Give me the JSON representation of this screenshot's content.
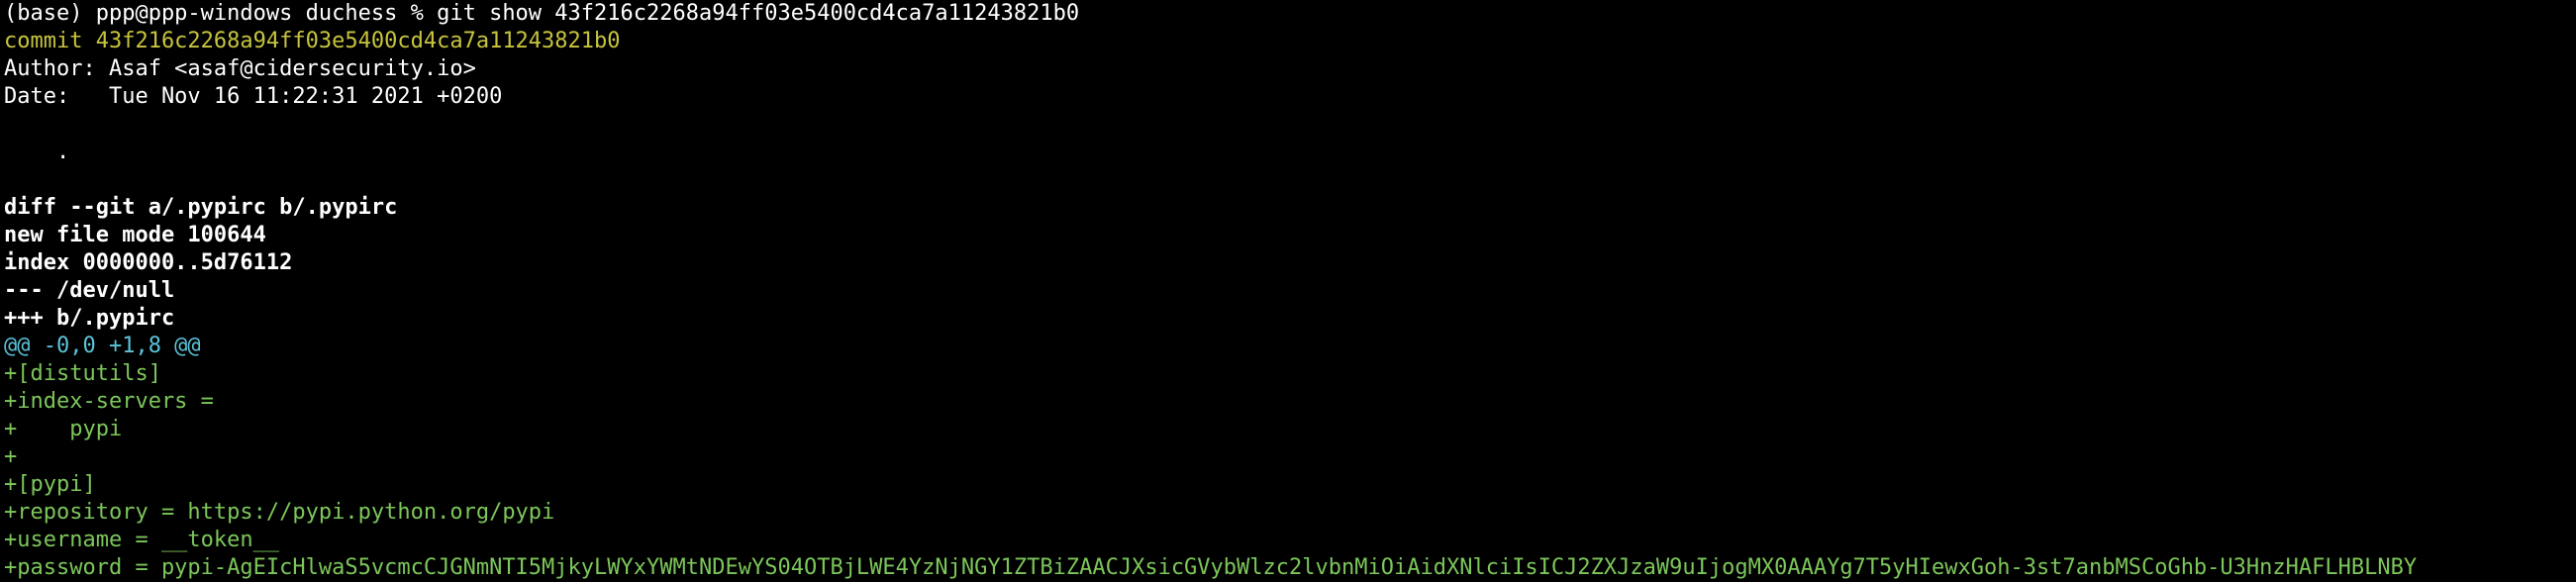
{
  "terminal": {
    "lines": [
      {
        "text": "(base) ppp@ppp-windows duchess % git show 43f216c2268a94ff03e5400cd4ca7a11243821b0",
        "kind": "prompt"
      },
      {
        "text": "commit 43f216c2268a94ff03e5400cd4ca7a11243821b0",
        "kind": "commit"
      },
      {
        "text": "Author: Asaf <asaf@cidersecurity.io>",
        "kind": "plain"
      },
      {
        "text": "Date:   Tue Nov 16 11:22:31 2021 +0200",
        "kind": "plain"
      },
      {
        "text": "",
        "kind": "plain"
      },
      {
        "text": "    .",
        "kind": "plain"
      },
      {
        "text": "",
        "kind": "plain"
      },
      {
        "text": "diff --git a/.pypirc b/.pypirc",
        "kind": "bold"
      },
      {
        "text": "new file mode 100644",
        "kind": "bold"
      },
      {
        "text": "index 0000000..5d76112",
        "kind": "bold"
      },
      {
        "text": "--- /dev/null",
        "kind": "bold"
      },
      {
        "text": "+++ b/.pypirc",
        "kind": "bold"
      },
      {
        "text": "@@ -0,0 +1,8 @@",
        "kind": "hunk"
      },
      {
        "text": "+[distutils]",
        "kind": "added"
      },
      {
        "text": "+index-servers =",
        "kind": "added"
      },
      {
        "text": "+    pypi",
        "kind": "added"
      },
      {
        "text": "+",
        "kind": "added"
      },
      {
        "text": "+[pypi]",
        "kind": "added"
      },
      {
        "text": "+repository = https://pypi.python.org/pypi",
        "kind": "added"
      },
      {
        "text": "+username = __token__",
        "kind": "added"
      },
      {
        "text": "+password = pypi-AgEIcHlwaS5vcmcCJGNmNTI5MjkyLWYxYWMtNDEwYS04OTBjLWE4YzNjNGY1ZTBiZAACJXsicGVybWlzc2lvbnMiOiAidXNlciIsICJ2ZXJzaW9uIjogMX0AAAYg7T5yHIewxGoh-3st7anbMSCoGhb-U3HnzHAFLHBLNBY",
        "kind": "added"
      }
    ]
  },
  "colors": {
    "background": "#000000",
    "commit": "#c7c43e",
    "hunk": "#5bc4d9",
    "added": "#7cc65a",
    "text": "#ffffff"
  }
}
